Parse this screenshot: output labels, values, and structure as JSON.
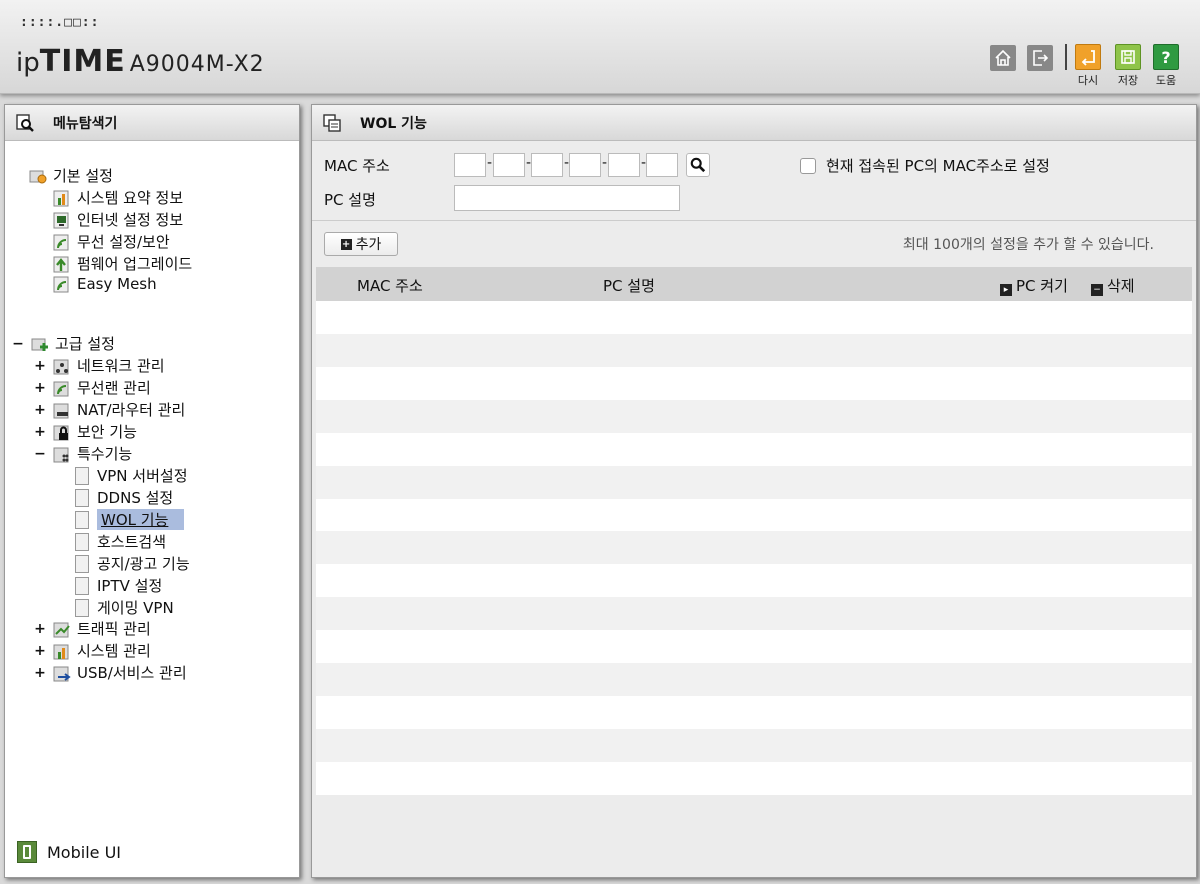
{
  "header": {
    "logo_dots": "::::.□□::",
    "logo_ip": "ip",
    "logo_time": "TIME",
    "model": "A9004M-X2",
    "tools": {
      "undo": "다시",
      "save": "저장",
      "help": "도움"
    }
  },
  "sidebar": {
    "title": "메뉴탐색기",
    "basic": {
      "label": "기본 설정",
      "items": [
        "시스템 요약 정보",
        "인터넷 설정 정보",
        "무선 설정/보안",
        "펌웨어 업그레이드",
        "Easy Mesh"
      ]
    },
    "advanced": {
      "toggle": "−",
      "label": "고급 설정",
      "groups": [
        {
          "toggle": "+",
          "label": "네트워크 관리"
        },
        {
          "toggle": "+",
          "label": "무선랜 관리"
        },
        {
          "toggle": "+",
          "label": "NAT/라우터 관리"
        },
        {
          "toggle": "+",
          "label": "보안 기능"
        },
        {
          "toggle": "−",
          "label": "특수기능"
        }
      ],
      "special_items": [
        "VPN 서버설정",
        "DDNS 설정",
        "WOL 기능",
        "호스트검색",
        "공지/광고 기능",
        "IPTV 설정",
        "게이밍 VPN"
      ],
      "more_groups": [
        {
          "toggle": "+",
          "label": "트래픽 관리"
        },
        {
          "toggle": "+",
          "label": "시스템 관리"
        },
        {
          "toggle": "+",
          "label": "USB/서비스 관리"
        }
      ]
    },
    "mobile_ui": "Mobile UI"
  },
  "main": {
    "title": "WOL 기능",
    "mac_label": "MAC 주소",
    "pc_desc_label": "PC 설명",
    "mac_separator": "-",
    "mac_fields": [
      "",
      "",
      "",
      "",
      "",
      ""
    ],
    "pc_desc_value": "",
    "current_pc_label": "현재 접속된 PC의 MAC주소로 설정",
    "current_pc_checked": false,
    "add_button": "추가",
    "max_note": "최대 100개의 설정을 추가 할 수 있습니다.",
    "columns": {
      "mac": "MAC 주소",
      "desc": "PC 설명",
      "wake": "PC 켜기",
      "delete": "삭제"
    },
    "rows": []
  }
}
